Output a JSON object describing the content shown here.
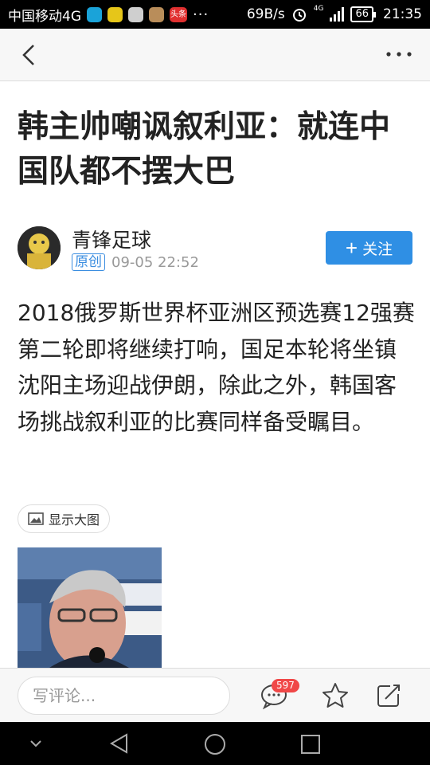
{
  "status_bar": {
    "carrier": "中国移动4G",
    "speed": "69B/s",
    "network_tag": "4G",
    "battery": "66",
    "time": "21:35",
    "app_icons": [
      "moon-app-icon",
      "green-app-icon",
      "face-app-icon",
      "bag-app-icon",
      "toutiao-app-icon"
    ],
    "toutiao_label": "头条",
    "overflow": "···"
  },
  "nav": {
    "back_icon": "chevron-left-icon",
    "more_icon": "more-dots-icon"
  },
  "article": {
    "title": "韩主帅嘲讽叙利亚：就连中国队都不摆大巴",
    "author": "青锋足球",
    "original_tag": "原创",
    "date": "09-05 22:52",
    "follow_plus": "+",
    "follow_label": "关注",
    "body": "2018俄罗斯世界杯亚洲区预选赛12强赛第二轮即将继续打响，国足本轮将坐镇沈阳主场迎战伊朗，除此之外，韩国客场挑战叙利亚的比赛同样备受瞩目。",
    "show_image_label": "显示大图"
  },
  "comment_bar": {
    "placeholder": "写评论...",
    "comment_count": "597"
  },
  "colors": {
    "accent": "#2f8fe4",
    "badge": "#f04848",
    "status_bar": "#000000"
  }
}
